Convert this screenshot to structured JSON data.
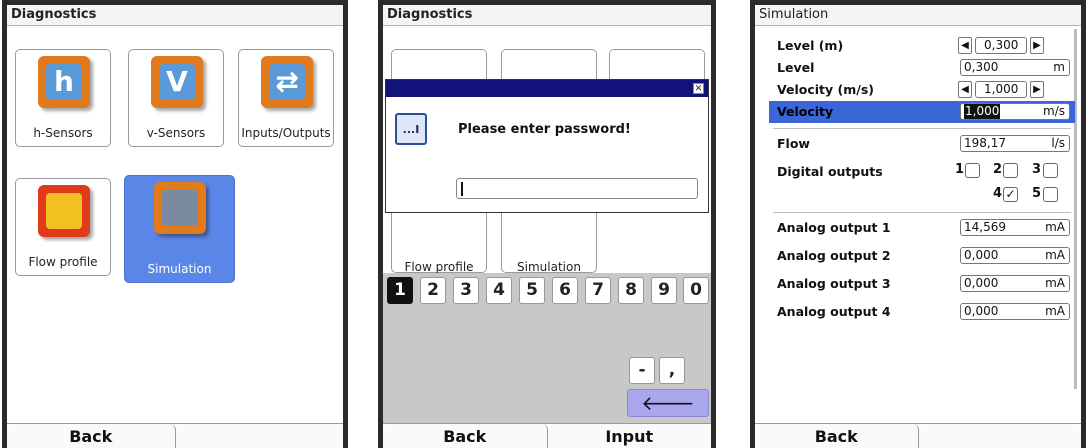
{
  "screen1": {
    "title": "Diagnostics",
    "tiles": [
      {
        "label": "h-Sensors",
        "glyph": "h",
        "icon": "h-sensor-icon"
      },
      {
        "label": "v-Sensors",
        "glyph": "V",
        "icon": "v-sensor-icon"
      },
      {
        "label": "Inputs/Outputs",
        "glyph": "⇄",
        "icon": "inputs-outputs-icon"
      },
      {
        "label": "Flow profile",
        "glyph": "",
        "icon": "flow-profile-icon"
      },
      {
        "label": "Simulation",
        "glyph": "",
        "icon": "simulation-icon",
        "selected": true
      }
    ],
    "bottom": {
      "back": "Back",
      "right": ""
    }
  },
  "screen2": {
    "title": "Diagnostics",
    "background_tiles": [
      {
        "label": "Flow profile"
      },
      {
        "label": "Simulation"
      }
    ],
    "dialog": {
      "close_glyph": "✕",
      "icon_text": "...I",
      "message": "Please enter password!",
      "input_value": ""
    },
    "keypad": {
      "digits": [
        "1",
        "2",
        "3",
        "4",
        "5",
        "6",
        "7",
        "8",
        "9",
        "0"
      ],
      "active_digit": "1",
      "minus": "-",
      "comma": ",",
      "enter_glyph": "🡐"
    },
    "bottom": {
      "back": "Back",
      "input": "Input"
    }
  },
  "screen3": {
    "title": "Simulation",
    "rows": {
      "level_m": {
        "label": "Level (m)",
        "value": "0,300"
      },
      "level": {
        "label": "Level",
        "value": "0,300",
        "unit": "m"
      },
      "velocity_ms": {
        "label": "Velocity (m/s)",
        "value": "1,000"
      },
      "velocity": {
        "label": "Velocity",
        "value": "1,000",
        "unit": "m/s"
      },
      "flow": {
        "label": "Flow",
        "value": "198,17",
        "unit": "l/s"
      },
      "digital": {
        "label": "Digital outputs",
        "outputs": [
          {
            "n": "1",
            "checked": false
          },
          {
            "n": "2",
            "checked": false
          },
          {
            "n": "3",
            "checked": false
          },
          {
            "n": "4",
            "checked": true
          },
          {
            "n": "5",
            "checked": false
          }
        ]
      },
      "analog1": {
        "label": "Analog output 1",
        "value": "14,569",
        "unit": "mA"
      },
      "analog2": {
        "label": "Analog output 2",
        "value": "0,000",
        "unit": "mA"
      },
      "analog3": {
        "label": "Analog output 3",
        "value": "0,000",
        "unit": "mA"
      },
      "analog4": {
        "label": "Analog output 4",
        "value": "0,000",
        "unit": "mA"
      }
    },
    "check_glyph": "✓",
    "bottom": {
      "back": "Back",
      "right": ""
    }
  },
  "colors": {
    "selection": "#5a86e8",
    "dialog_header": "#12127a",
    "highlight_row": "#3a66d8",
    "enter_key": "#a9a6ee"
  }
}
